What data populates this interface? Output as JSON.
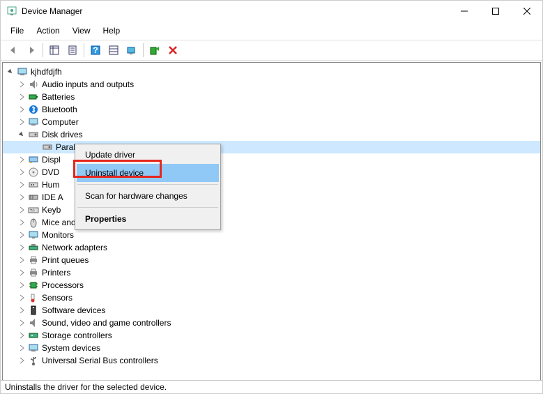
{
  "window": {
    "title": "Device Manager"
  },
  "menu": {
    "file": "File",
    "action": "Action",
    "view": "View",
    "help": "Help"
  },
  "tree": {
    "root": "kjhdfdjfh",
    "items": [
      "Audio inputs and outputs",
      "Batteries",
      "Bluetooth",
      "Computer",
      "Disk drives",
      "Display adapters",
      "DVD/CD-ROM drives",
      "Human Interface Devices",
      "IDE ATA/ATAPI controllers",
      "Keyboards",
      "Mice and other pointing devices",
      "Monitors",
      "Network adapters",
      "Print queues",
      "Printers",
      "Processors",
      "Sensors",
      "Software devices",
      "Sound, video and game controllers",
      "Storage controllers",
      "System devices",
      "Universal Serial Bus controllers"
    ],
    "disk_child": "Parallels Virtual NVMe Disk",
    "truncated": {
      "display": "Displ",
      "dvd": "DVD",
      "hid": "Hum",
      "ide": "IDE A",
      "keyb": "Keyb"
    }
  },
  "context_menu": {
    "update": "Update driver",
    "uninstall": "Uninstall device",
    "scan": "Scan for hardware changes",
    "properties": "Properties"
  },
  "status": "Uninstalls the driver for the selected device."
}
